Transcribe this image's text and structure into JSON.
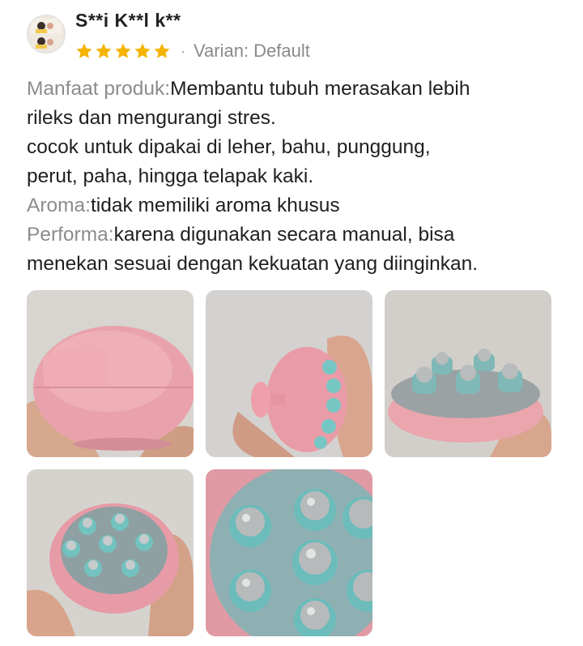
{
  "review": {
    "username": "S**i K**l k**",
    "rating": 5,
    "rating_max": 5,
    "separator": "·",
    "variant": "Varian: Default",
    "sections": [
      {
        "label": "Manfaat produk:",
        "lines": [
          "Membantu tubuh merasakan lebih",
          "rileks dan mengurangi stres.",
          "cocok untuk dipakai di leher, bahu, punggung,",
          "perut, paha, hingga telapak kaki."
        ]
      },
      {
        "label": "Aroma:",
        "lines": [
          "tidak memiliki aroma khusus"
        ]
      },
      {
        "label": "Performa:",
        "lines": [
          "karena digunakan secara manual, bisa",
          "menekan sesuai dengan kekuatan yang diinginkan."
        ]
      }
    ],
    "photo_count": 5
  },
  "colors": {
    "star": "#f5b400",
    "label_gray": "#8c8c8c",
    "product_pink": "#e99aa6",
    "roller_teal": "#7fc9c7"
  },
  "icons": {
    "star": "star-icon"
  }
}
